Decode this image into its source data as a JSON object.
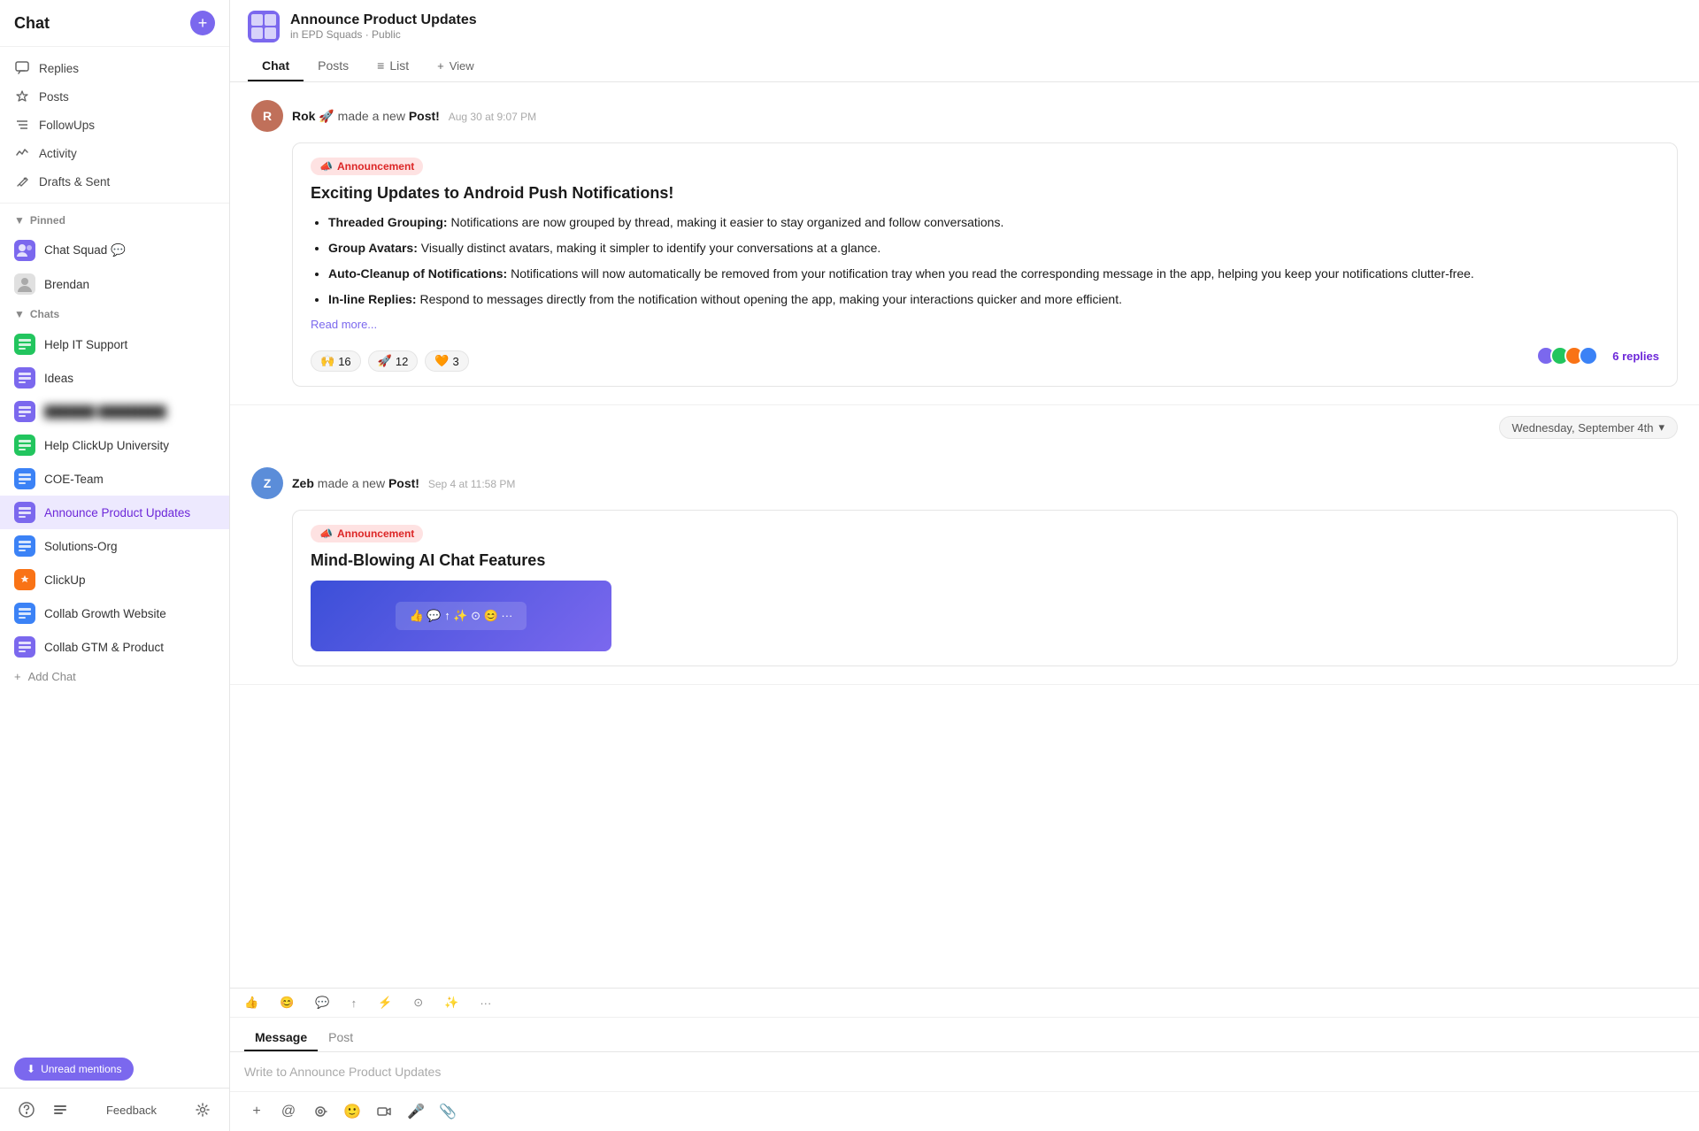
{
  "sidebar": {
    "title": "Chat",
    "add_button_label": "+",
    "nav_items": [
      {
        "id": "replies",
        "label": "Replies",
        "icon": "💬"
      },
      {
        "id": "posts",
        "label": "Posts",
        "icon": "△"
      },
      {
        "id": "followups",
        "label": "FollowUps",
        "icon": "≋"
      },
      {
        "id": "activity",
        "label": "Activity",
        "icon": "∿"
      },
      {
        "id": "drafts",
        "label": "Drafts & Sent",
        "icon": "➤"
      }
    ],
    "pinned_section": "Pinned",
    "pinned_items": [
      {
        "id": "chat-squad",
        "name": "Chat Squad",
        "suffix": "💬",
        "color": "purple"
      },
      {
        "id": "brendan",
        "name": "Brendan",
        "color": "gray"
      }
    ],
    "chats_section": "Chats",
    "chat_items": [
      {
        "id": "help-it",
        "name": "Help IT Support",
        "color": "green"
      },
      {
        "id": "ideas",
        "name": "Ideas",
        "color": "purple"
      },
      {
        "id": "blurred",
        "name": "██████ ████████",
        "color": "purple",
        "blurred": true
      },
      {
        "id": "help-clickup",
        "name": "Help ClickUp University",
        "color": "green"
      },
      {
        "id": "coe-team",
        "name": "COE-Team",
        "color": "blue"
      },
      {
        "id": "announce",
        "name": "Announce Product Updates",
        "color": "purple",
        "active": true
      },
      {
        "id": "solutions-org",
        "name": "Solutions-Org",
        "color": "blue"
      },
      {
        "id": "clickup",
        "name": "ClickUp",
        "color": "orange"
      },
      {
        "id": "collab-growth",
        "name": "Collab Growth Website",
        "color": "blue"
      },
      {
        "id": "collab-gtm",
        "name": "Collab GTM & Product",
        "color": "purple"
      }
    ],
    "add_chat_label": "Add Chat",
    "unread_btn_label": "Unread mentions",
    "footer": {
      "feedback_label": "Feedback"
    }
  },
  "main": {
    "channel_name": "Announce Product Updates",
    "channel_sub": "in EPD Squads · Public",
    "tabs": [
      {
        "id": "chat",
        "label": "Chat",
        "active": true
      },
      {
        "id": "posts",
        "label": "Posts"
      },
      {
        "id": "list",
        "label": "List"
      },
      {
        "id": "view",
        "label": "View"
      }
    ],
    "messages": [
      {
        "id": "msg1",
        "author": "Rok 🚀",
        "action": "made a new",
        "action_highlight": "Post!",
        "time": "Aug 30 at 9:07 PM",
        "badge": "📣 Announcement",
        "post_title": "Exciting Updates to Android Push Notifications!",
        "post_items": [
          {
            "bold": "Threaded Grouping:",
            "text": " Notifications are now grouped by thread, making it easier to stay organized and follow conversations."
          },
          {
            "bold": "Group Avatars:",
            "text": " Visually distinct avatars, making it simpler to identify your conversations at a glance."
          },
          {
            "bold": "Auto-Cleanup of Notifications:",
            "text": " Notifications will now automatically be removed from your notification tray when you read the corresponding message in the app, helping you keep your notifications clutter-free."
          },
          {
            "bold": "In-line Replies:",
            "text": " Respond to messages directly from the notification without opening the app, making your interactions quicker and more efficient."
          }
        ],
        "read_more": "Read more...",
        "reactions": [
          {
            "emoji": "🙌",
            "count": "16"
          },
          {
            "emoji": "🚀",
            "count": "12"
          },
          {
            "emoji": "🧡",
            "count": "3"
          }
        ],
        "reply_count": "6 replies"
      },
      {
        "id": "msg2",
        "author": "Zeb",
        "action": "made a new",
        "action_highlight": "Post!",
        "time": "Sep 4 at 11:58 PM",
        "badge": "📣 Announcement",
        "post_title": "Mind-Blowing AI Chat Features",
        "has_image": true
      }
    ],
    "date_divider": "Wednesday, September 4th",
    "input": {
      "message_tab": "Message",
      "post_tab": "Post",
      "placeholder": "Write to Announce Product Updates"
    }
  }
}
